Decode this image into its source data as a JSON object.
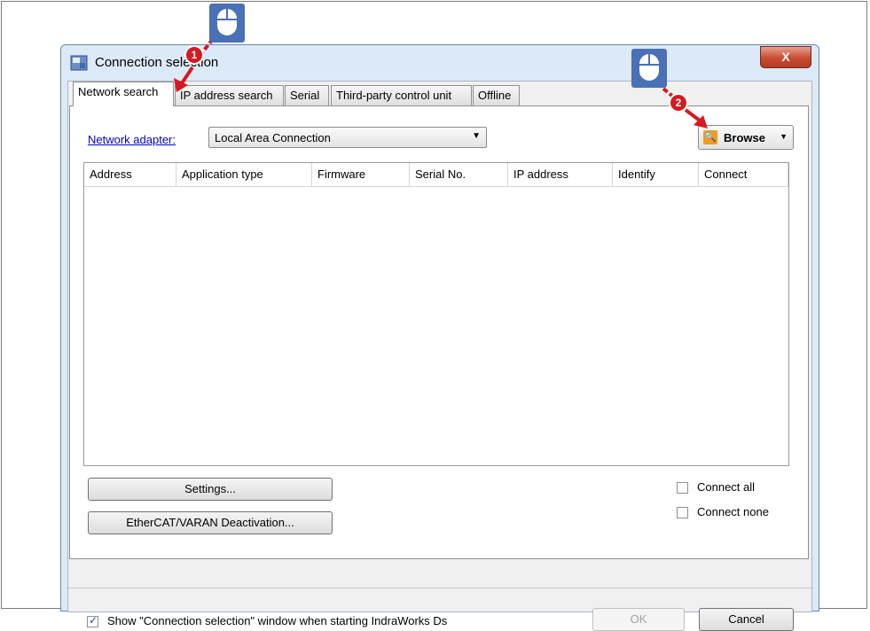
{
  "window": {
    "title": "Connection selection",
    "close_label": "X"
  },
  "tabs": [
    {
      "label": "Network search",
      "active": true
    },
    {
      "label": "IP address search",
      "active": false
    },
    {
      "label": "Serial",
      "active": false
    },
    {
      "label": "Third-party control unit",
      "active": false
    },
    {
      "label": "Offline",
      "active": false
    }
  ],
  "adapter": {
    "label": "Network adapter:",
    "value": "Local Area Connection"
  },
  "browse": {
    "label": "Browse",
    "icon": "search-icon"
  },
  "table": {
    "columns": [
      "Address",
      "Application type",
      "Firmware",
      "Serial No.",
      "IP address",
      "Identify",
      "Connect"
    ],
    "rows": []
  },
  "buttons": {
    "settings": "Settings...",
    "ethercat": "EtherCAT/VARAN Deactivation...",
    "ok": "OK",
    "cancel": "Cancel"
  },
  "checkboxes": {
    "connect_all": {
      "label": "Connect all",
      "checked": false
    },
    "connect_none": {
      "label": "Connect none",
      "checked": false
    },
    "show_on_start": {
      "label": "Show \"Connection selection\" window when starting IndraWorks Ds",
      "checked": true
    }
  },
  "annotations": {
    "step1": "1",
    "step2": "2",
    "marker_color": "#d71920",
    "mouse_color": "#4a70b5"
  }
}
